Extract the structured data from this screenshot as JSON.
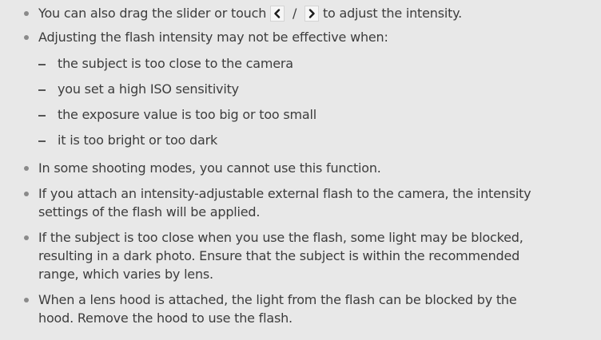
{
  "notes": {
    "drag_tip": {
      "prefix": "You can also drag the slider or touch",
      "separator": "/",
      "suffix": "to adjust the intensity.",
      "left_icon": "chevron-left-icon",
      "right_icon": "chevron-right-icon"
    },
    "ineffective_intro": "Adjusting the flash intensity may not be effective when:",
    "conditions": [
      "the subject is too close to the camera",
      "you set a high ISO sensitivity",
      "the exposure value is too big or too small",
      "it is too bright or too dark"
    ],
    "shooting_modes": "In some shooting modes, you cannot use this function.",
    "external_flash": {
      "line1": "If you attach an intensity-adjustable external flash to the camera, the intensity",
      "line2": "settings of the flash will be applied."
    },
    "too_close": {
      "line1": "If the subject is too close when you use the flash, some light may be blocked,",
      "line2": "resulting in a dark photo. Ensure that the subject is within the recommended",
      "line3": "range, which varies by lens."
    },
    "lens_hood": {
      "line1": "When a lens hood is attached, the light from the flash can be blocked by the",
      "line2": "hood. Remove the hood to use the flash."
    }
  }
}
